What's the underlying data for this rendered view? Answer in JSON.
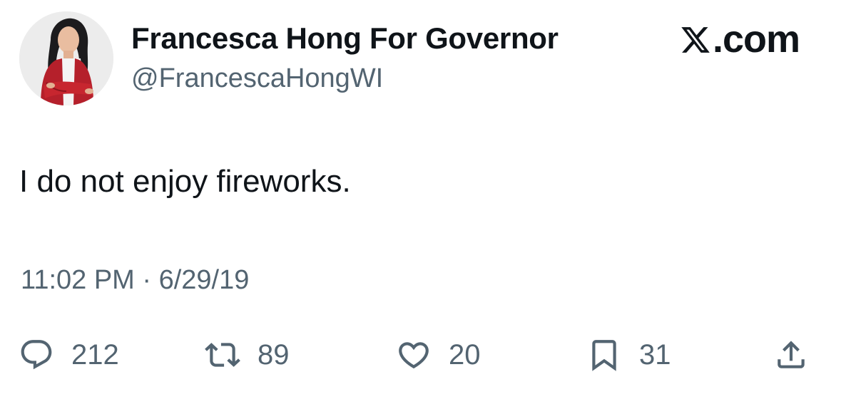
{
  "author": {
    "display_name": "Francesca Hong For Governor",
    "handle": "@FrancescaHongWI"
  },
  "brand": {
    "label": ".com",
    "icon": "x-logo-icon"
  },
  "tweet": {
    "text": "I do not enjoy fireworks.",
    "timestamp": "11:02 PM · 6/29/19"
  },
  "actions": {
    "reply": {
      "icon": "reply-icon",
      "count": "212"
    },
    "retweet": {
      "icon": "retweet-icon",
      "count": "89"
    },
    "like": {
      "icon": "heart-icon",
      "count": "20"
    },
    "bookmark": {
      "icon": "bookmark-icon",
      "count": "31"
    },
    "share": {
      "icon": "share-icon"
    }
  },
  "colors": {
    "text_primary": "#0f1419",
    "text_secondary": "#536471",
    "background": "#ffffff"
  }
}
